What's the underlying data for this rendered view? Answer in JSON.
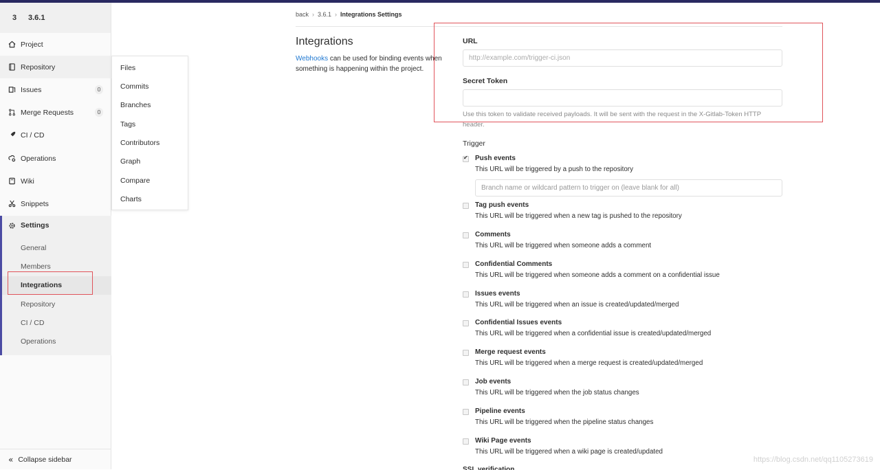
{
  "project": {
    "avatar_letter": "3",
    "name": "3.6.1"
  },
  "sidebar": {
    "items": [
      {
        "label": "Project",
        "icon": "home-icon"
      },
      {
        "label": "Repository",
        "icon": "book-icon"
      },
      {
        "label": "Issues",
        "icon": "issues-icon",
        "count": "0"
      },
      {
        "label": "Merge Requests",
        "icon": "merge-request-icon",
        "count": "0"
      },
      {
        "label": "CI / CD",
        "icon": "rocket-icon"
      },
      {
        "label": "Operations",
        "icon": "cloud-gear-icon"
      },
      {
        "label": "Wiki",
        "icon": "book-open-icon"
      },
      {
        "label": "Snippets",
        "icon": "scissors-icon"
      }
    ],
    "settings": {
      "label": "Settings",
      "icon": "gear-icon",
      "sub": [
        "General",
        "Members",
        "Integrations",
        "Repository",
        "CI / CD",
        "Operations"
      ]
    },
    "collapse_label": "Collapse sidebar"
  },
  "flyout": {
    "items": [
      "Files",
      "Commits",
      "Branches",
      "Tags",
      "Contributors",
      "Graph",
      "Compare",
      "Charts"
    ]
  },
  "breadcrumb": {
    "items": [
      "back",
      "3.6.1"
    ],
    "current": "Integrations Settings"
  },
  "intro": {
    "title": "Integrations",
    "link": "Webhooks",
    "text": " can be used for binding events when something is happening within the project."
  },
  "form": {
    "url_label": "URL",
    "url_placeholder": "http://example.com/trigger-ci.json",
    "token_label": "Secret Token",
    "token_help": "Use this token to validate received payloads. It will be sent with the request in the X-Gitlab-Token HTTP header.",
    "trigger_label": "Trigger",
    "branch_placeholder": "Branch name or wildcard pattern to trigger on (leave blank for all)",
    "events": [
      {
        "title": "Push events",
        "desc": "This URL will be triggered by a push to the repository",
        "checked": true
      },
      {
        "title": "Tag push events",
        "desc": "This URL will be triggered when a new tag is pushed to the repository",
        "checked": false
      },
      {
        "title": "Comments",
        "desc": "This URL will be triggered when someone adds a comment",
        "checked": false
      },
      {
        "title": "Confidential Comments",
        "desc": "This URL will be triggered when someone adds a comment on a confidential issue",
        "checked": false
      },
      {
        "title": "Issues events",
        "desc": "This URL will be triggered when an issue is created/updated/merged",
        "checked": false
      },
      {
        "title": "Confidential Issues events",
        "desc": "This URL will be triggered when a confidential issue is created/updated/merged",
        "checked": false
      },
      {
        "title": "Merge request events",
        "desc": "This URL will be triggered when a merge request is created/updated/merged",
        "checked": false
      },
      {
        "title": "Job events",
        "desc": "This URL will be triggered when the job status changes",
        "checked": false
      },
      {
        "title": "Pipeline events",
        "desc": "This URL will be triggered when the pipeline status changes",
        "checked": false
      },
      {
        "title": "Wiki Page events",
        "desc": "This URL will be triggered when a wiki page is created/updated",
        "checked": false
      }
    ],
    "ssl_label": "SSL verification"
  },
  "watermark": "https://blog.csdn.net/qq1105273619",
  "colors": {
    "accent": "#4b4ba3",
    "highlight": "#e0535a",
    "link": "#1f78d1"
  }
}
